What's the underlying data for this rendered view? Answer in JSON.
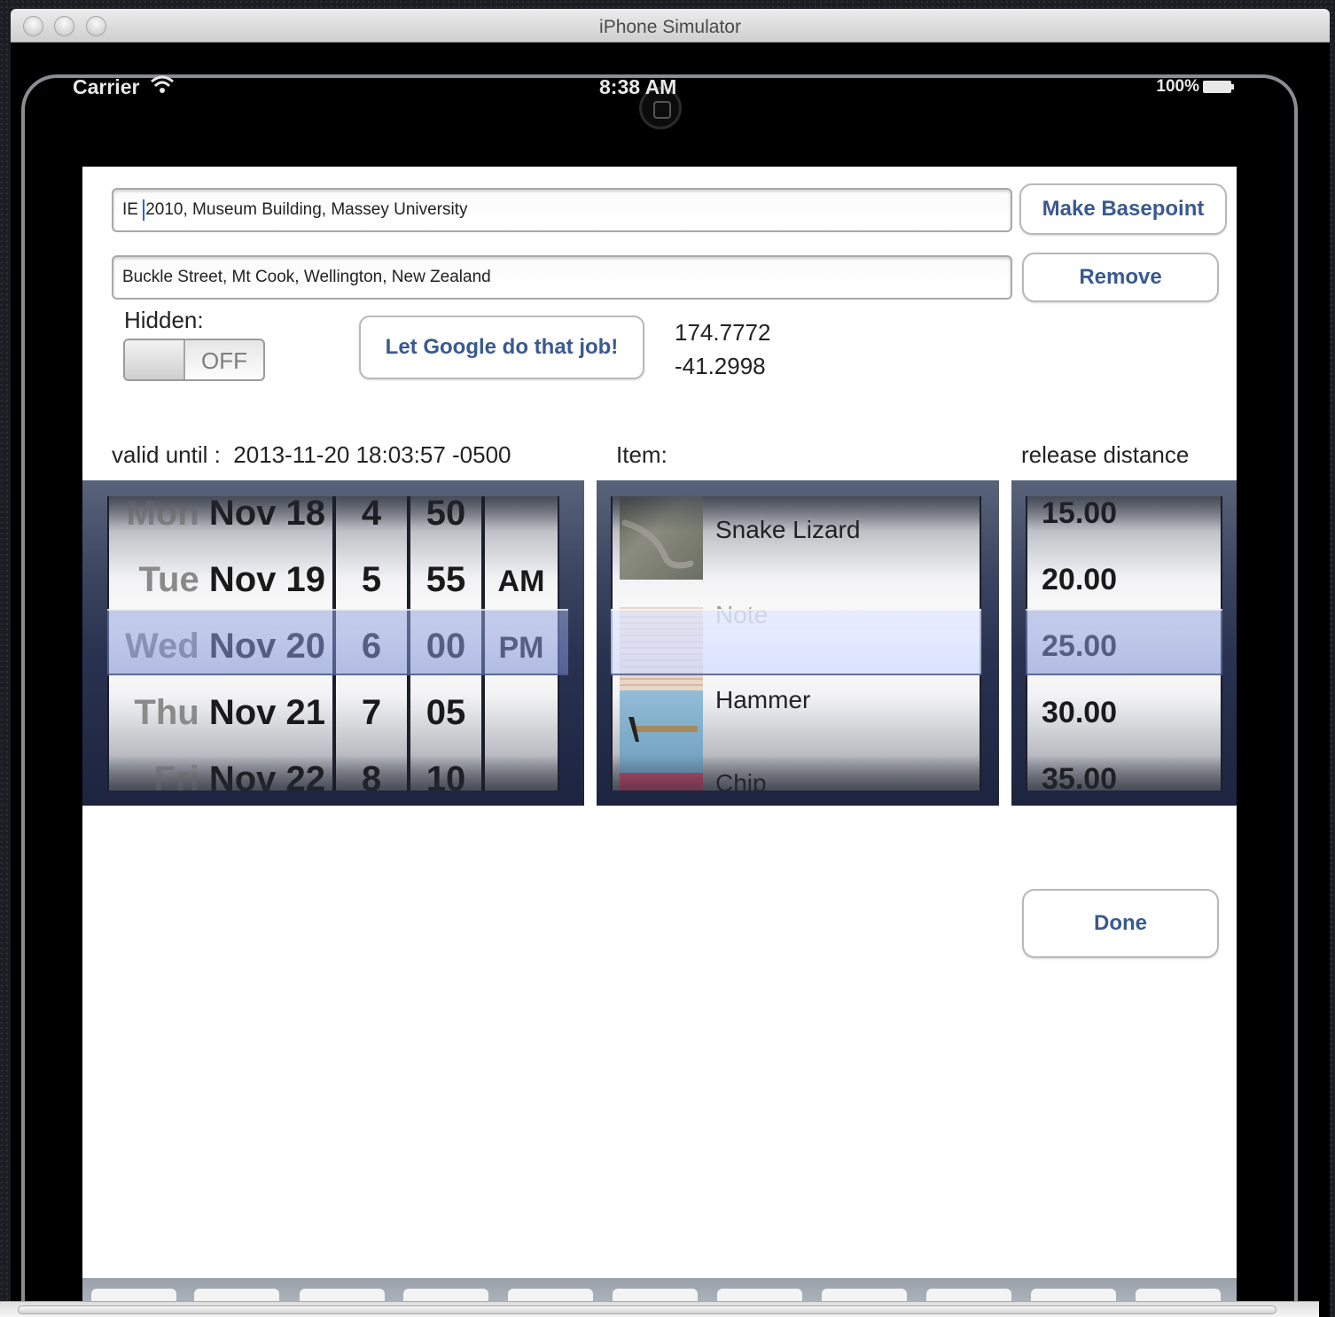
{
  "window": {
    "title": "iPhone Simulator"
  },
  "statusbar": {
    "carrier": "Carrier",
    "time": "8:38 AM",
    "battery": "100%"
  },
  "form": {
    "address1": "IE 2010, Museum Building, Massey University",
    "address1_prefix": "IE ",
    "address1_rest": "2010, Museum Building, Massey University",
    "address2": "Buckle Street, Mt Cook, Wellington, New Zealand",
    "make_basepoint": "Make Basepoint",
    "remove": "Remove",
    "hidden_label": "Hidden:",
    "hidden_switch": "OFF",
    "google_button": "Let Google do that job!",
    "longitude": "174.7772",
    "latitude": "-41.2998",
    "valid_until_label": "valid until :",
    "valid_until_value": "2013-11-20 18:03:57 -0500",
    "item_label": "Item:",
    "release_label": "release distance",
    "done": "Done"
  },
  "date_picker": {
    "days": [
      {
        "dow": "Mon",
        "date": "Nov 18"
      },
      {
        "dow": "Tue",
        "date": "Nov 19"
      },
      {
        "dow": "Wed",
        "date": "Nov 20"
      },
      {
        "dow": "Thu",
        "date": "Nov 21"
      },
      {
        "dow": "Fri",
        "date": "Nov 22"
      }
    ],
    "hours": [
      "4",
      "5",
      "6",
      "7",
      "8"
    ],
    "minutes": [
      "50",
      "55",
      "00",
      "05",
      "10"
    ],
    "ampm": [
      "AM",
      "PM"
    ],
    "selected_index": 2
  },
  "item_picker": {
    "items": [
      "Snake Lizard",
      "Note",
      "Hammer",
      "Chip"
    ],
    "selected": "Note"
  },
  "distance_picker": {
    "values": [
      "15.00",
      "20.00",
      "25.00",
      "30.00",
      "35.00"
    ],
    "selected": "25.00"
  }
}
